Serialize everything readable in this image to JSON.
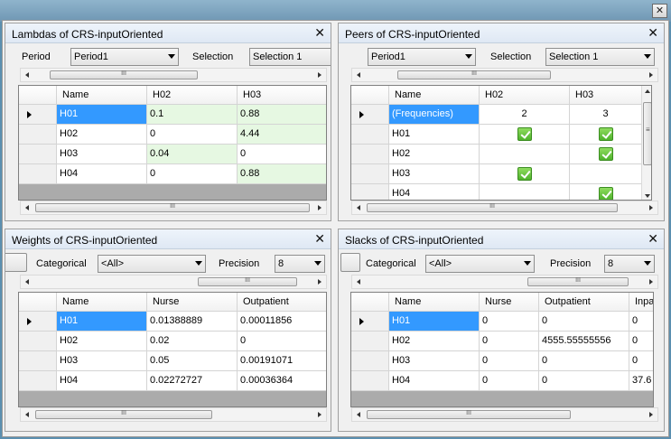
{
  "window": {
    "close_icon": "✕"
  },
  "icons": {
    "close": "✕",
    "grip": "III",
    "grip_v": "≡"
  },
  "lambdas": {
    "title": "Lambdas of CRS-inputOriented",
    "period_label": "Period",
    "period_value": "Period1",
    "selection_label": "Selection",
    "selection_value": "Selection 1",
    "columns": [
      "Name",
      "H02",
      "H03"
    ],
    "rows": [
      {
        "name": "H01",
        "v": [
          "0.1",
          "0.88"
        ]
      },
      {
        "name": "H02",
        "v": [
          "0",
          "4.44"
        ]
      },
      {
        "name": "H03",
        "v": [
          "0.04",
          "0"
        ]
      },
      {
        "name": "H04",
        "v": [
          "0",
          "0.88"
        ]
      }
    ]
  },
  "peers": {
    "title": "Peers of CRS-inputOriented",
    "period_value": "Period1",
    "selection_label": "Selection",
    "selection_value": "Selection 1",
    "columns": [
      "Name",
      "H02",
      "H03"
    ],
    "rows": [
      {
        "name": "(Frequencies)",
        "v": [
          "2",
          "3"
        ]
      },
      {
        "name": "H01",
        "check": [
          true,
          true
        ]
      },
      {
        "name": "H02",
        "check": [
          false,
          true
        ]
      },
      {
        "name": "H03",
        "check": [
          true,
          false
        ]
      },
      {
        "name": "H04",
        "check": [
          false,
          true
        ]
      }
    ]
  },
  "weights": {
    "title": "Weights of CRS-inputOriented",
    "categorical_label": "Categorical",
    "categorical_value": "<All>",
    "precision_label": "Precision",
    "precision_value": "8",
    "columns": [
      "Name",
      "Nurse",
      "Outpatient"
    ],
    "rows": [
      {
        "name": "H01",
        "v": [
          "0.01388889",
          "0.00011856"
        ]
      },
      {
        "name": "H02",
        "v": [
          "0.02",
          "0"
        ]
      },
      {
        "name": "H03",
        "v": [
          "0.05",
          "0.00191071"
        ]
      },
      {
        "name": "H04",
        "v": [
          "0.02272727",
          "0.00036364"
        ]
      }
    ]
  },
  "slacks": {
    "title": "Slacks of CRS-inputOriented",
    "categorical_label": "Categorical",
    "categorical_value": "<All>",
    "precision_label": "Precision",
    "precision_value": "8",
    "columns": [
      "Name",
      "Nurse",
      "Outpatient",
      "Inpa"
    ],
    "rows": [
      {
        "name": "H01",
        "v": [
          "0",
          "0",
          "0"
        ]
      },
      {
        "name": "H02",
        "v": [
          "0",
          "4555.55555556",
          "0"
        ]
      },
      {
        "name": "H03",
        "v": [
          "0",
          "0",
          "0"
        ]
      },
      {
        "name": "H04",
        "v": [
          "0",
          "0",
          "37.6"
        ]
      }
    ]
  }
}
